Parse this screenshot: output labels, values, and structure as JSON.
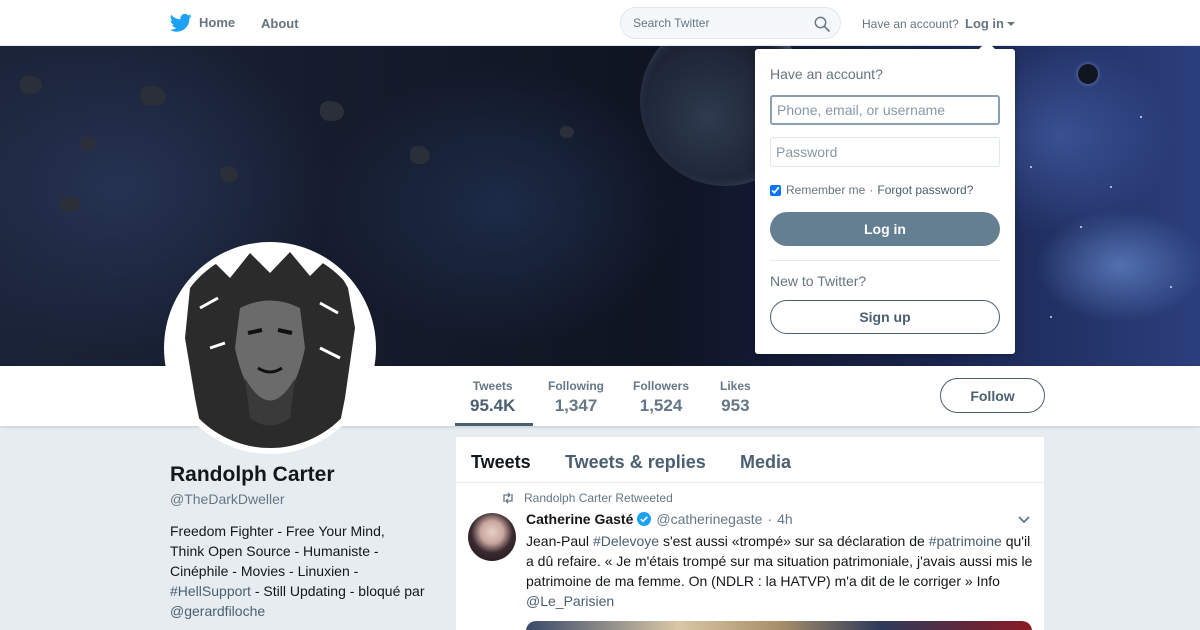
{
  "colors": {
    "accent": "#4a6072",
    "link": "#4a6072",
    "twitter_blue": "#1da1f2"
  },
  "nav": {
    "home_label": "Home",
    "about_label": "About",
    "search_placeholder": "Search Twitter",
    "have_account": "Have an account?",
    "login_label": "Log in"
  },
  "icons": {
    "logo": "twitter-bird-icon",
    "search": "search-icon",
    "retweet": "retweet-icon",
    "verified": "verified-badge-icon",
    "chevron": "chevron-down-icon"
  },
  "profile": {
    "name": "Randolph Carter",
    "handle": "@TheDarkDweller",
    "bio_line1": "Freedom Fighter - Free Your Mind,",
    "bio_line2": "Think Open Source - Humaniste -",
    "bio_line3": "Cinéphile - Movies - Linuxien -",
    "bio_hashtag": "#HellSupport",
    "bio_line4_rest": " - Still Updating - bloqué par",
    "bio_mention": "@gerardfiloche"
  },
  "stats": [
    {
      "label": "Tweets",
      "value": "95.4K"
    },
    {
      "label": "Following",
      "value": "1,347"
    },
    {
      "label": "Followers",
      "value": "1,524"
    },
    {
      "label": "Likes",
      "value": "953"
    }
  ],
  "follow_label": "Follow",
  "timeline": {
    "tabs": [
      "Tweets",
      "Tweets & replies",
      "Media"
    ],
    "retweet_context": "Randolph Carter Retweeted",
    "tweet": {
      "author_name": "Catherine Gasté",
      "author_handle": "@catherinegaste",
      "separator": "·",
      "time": "4h",
      "t1": "Jean-Paul ",
      "h1": "#Delevoye",
      "t2": " s'est aussi «trompé» sur sa déclaration de ",
      "h2": "#patrimoine",
      "t3": " qu'il a dû refaire. « Je m'étais trompé sur ma situation patrimoniale, j'avais aussi mis le patrimoine de ma femme. On (NDLR : la HATVP) m'a dit de le corriger » Info ",
      "m1": "@Le_Parisien"
    }
  },
  "login_dropdown": {
    "title": "Have an account?",
    "username_placeholder": "Phone, email, or username",
    "password_placeholder": "Password",
    "remember_me": "Remember me",
    "separator": "·",
    "forgot_password": "Forgot password?",
    "remember_checked": true,
    "login_button": "Log in",
    "new_to_twitter": "New to Twitter?",
    "signup_button": "Sign up"
  }
}
